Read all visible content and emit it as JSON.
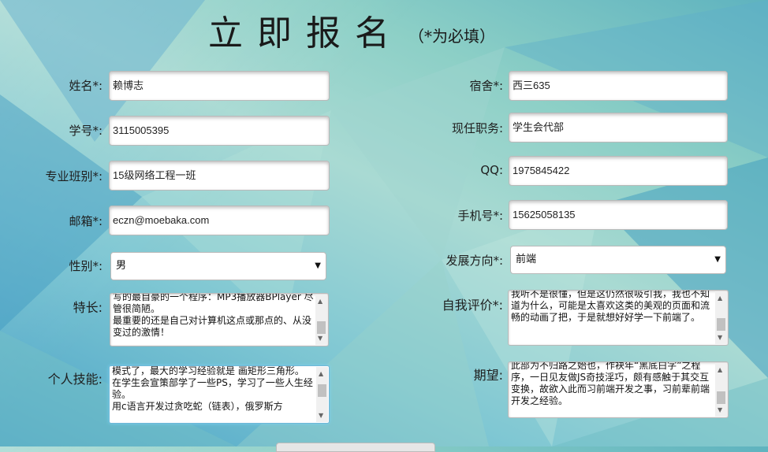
{
  "title": "立即报名",
  "subtitle": "（*为必填）",
  "left_fields": [
    {
      "label": "姓名*:",
      "value": "赖博志"
    },
    {
      "label": "学号*:",
      "value": "3115005395"
    },
    {
      "label": "专业班别*:",
      "value": "15级网络工程一班"
    },
    {
      "label": "邮箱*:",
      "value": "eczn@moebaka.com"
    }
  ],
  "right_fields": [
    {
      "label": "宿舍*:",
      "value": "西三635"
    },
    {
      "label": "现任职务:",
      "value": "学生会代部"
    },
    {
      "label": "QQ:",
      "value": "1975845422"
    },
    {
      "label": "手机号*:",
      "value": "15625058135"
    }
  ],
  "gender": {
    "label": "性别*:",
    "value": "男"
  },
  "direction": {
    "label": "发展方向*:",
    "value": "前端"
  },
  "specialty": {
    "label": "特长:",
    "text": "写的最自豪的一个程序：MP3播放器BPlayer 尽管很简陋。\n最重要的还是自己对计算机这点或那点的、从没变过的激情！"
  },
  "self_eval": {
    "label": "自我评价*:",
    "text": "我听不是很懂，但是这仍然很吸引我，我也不知道为什么，可能是太喜欢这类的美观的页面和流畅的动画了把，于是就想好好学一下前端了。"
  },
  "skills": {
    "label": "个人技能:",
    "text": "模式了，最大的学习经验就是 画矩形三角形。\n在学生会宣策部学了一些PS，学习了一些人生经验。\n用c语言开发过贪吃蛇（链表），俄罗斯方"
  },
  "expectation": {
    "label": "期望:",
    "text": "此部为不归路之始也，作袂年“黑底白字”之程序，一日见友做JS奇技淫巧，颇有感触于其交互变换，故欲入此而习前端开发之事，习前辈前端开发之经验。"
  },
  "colors": {
    "accent": "#6fb7d8",
    "bg_teal": "#8ccfc6",
    "bg_blue": "#4aa3c7"
  }
}
